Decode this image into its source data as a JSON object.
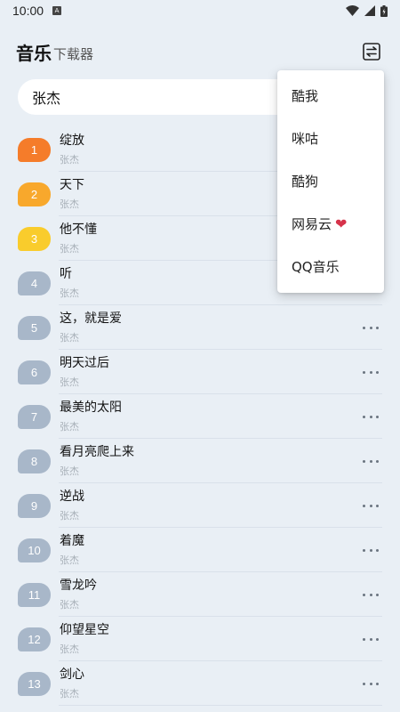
{
  "status_bar": {
    "time": "10:00",
    "notification_icon": "A"
  },
  "header": {
    "title": "音乐",
    "subtitle": "下载器",
    "action_icon": "swap-icon"
  },
  "search": {
    "value": "张杰"
  },
  "songs": [
    {
      "rank": "1",
      "name": "绽放",
      "artist": "张杰",
      "badge_color": "#f57c2a"
    },
    {
      "rank": "2",
      "name": "天下",
      "artist": "张杰",
      "badge_color": "#f8a82c"
    },
    {
      "rank": "3",
      "name": "他不懂",
      "artist": "张杰",
      "badge_color": "#f9cc2c"
    },
    {
      "rank": "4",
      "name": "听",
      "artist": "张杰",
      "badge_color": "#a8b7c9"
    },
    {
      "rank": "5",
      "name": "这，就是爱",
      "artist": "张杰",
      "badge_color": "#a8b7c9"
    },
    {
      "rank": "6",
      "name": "明天过后",
      "artist": "张杰",
      "badge_color": "#a8b7c9"
    },
    {
      "rank": "7",
      "name": "最美的太阳",
      "artist": "张杰",
      "badge_color": "#a8b7c9"
    },
    {
      "rank": "8",
      "name": "看月亮爬上来",
      "artist": "张杰",
      "badge_color": "#a8b7c9"
    },
    {
      "rank": "9",
      "name": "逆战",
      "artist": "张杰",
      "badge_color": "#a8b7c9"
    },
    {
      "rank": "10",
      "name": "着魔",
      "artist": "张杰",
      "badge_color": "#a8b7c9"
    },
    {
      "rank": "11",
      "name": "雪龙吟",
      "artist": "张杰",
      "badge_color": "#a8b7c9"
    },
    {
      "rank": "12",
      "name": "仰望星空",
      "artist": "张杰",
      "badge_color": "#a8b7c9"
    },
    {
      "rank": "13",
      "name": "剑心",
      "artist": "张杰",
      "badge_color": "#a8b7c9"
    }
  ],
  "source_menu": {
    "items": [
      {
        "label": "酷我"
      },
      {
        "label": "咪咕"
      },
      {
        "label": "酷狗"
      },
      {
        "label": "网易云"
      },
      {
        "label": "QQ音乐"
      }
    ],
    "heart_icon": "heart-icon",
    "heart_color": "#d6334a"
  }
}
